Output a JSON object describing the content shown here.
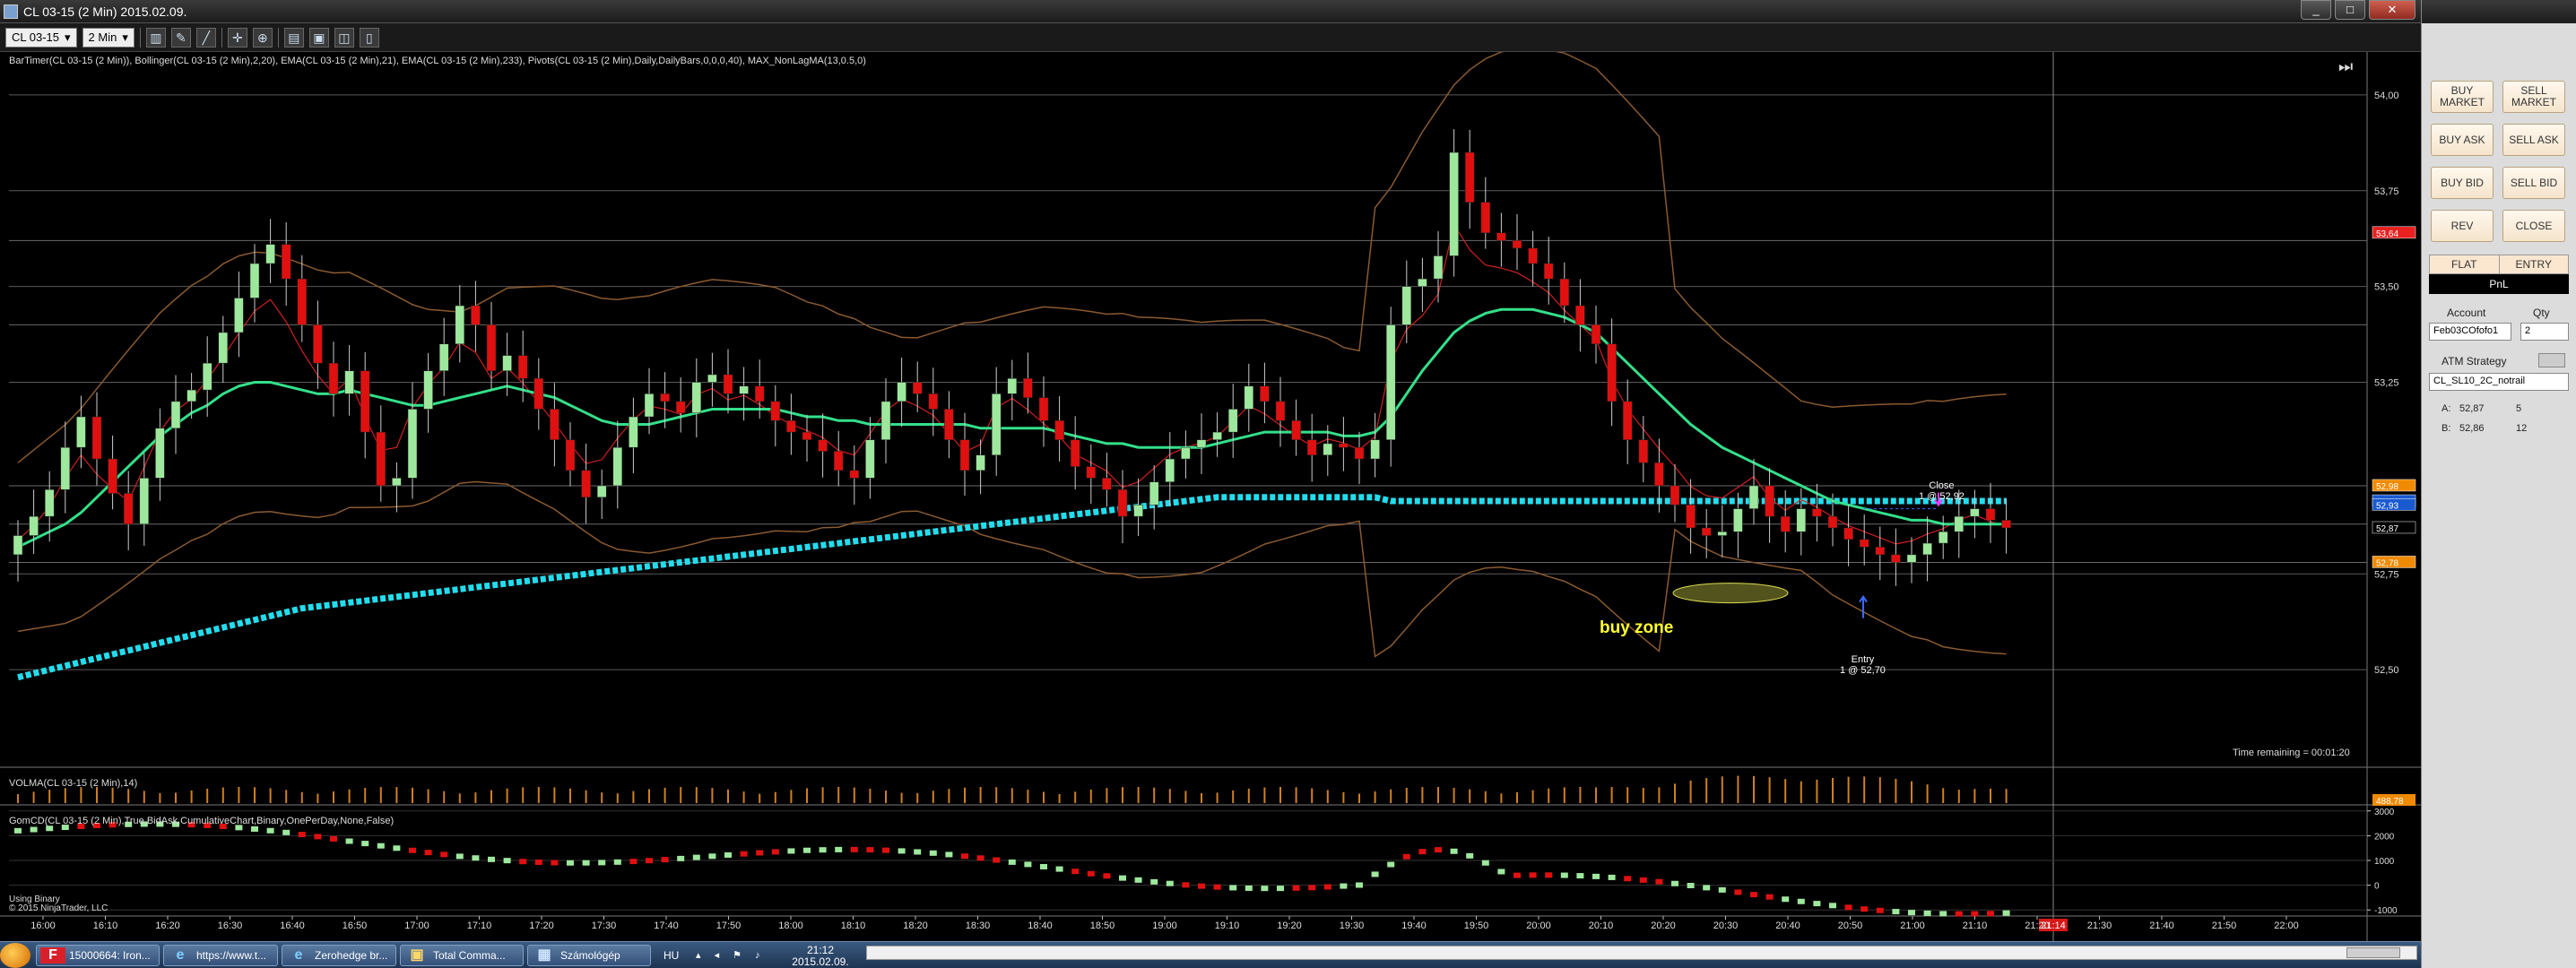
{
  "window": {
    "title": "CL 03-15 (2 Min)  2015.02.09.",
    "min_glyph": "_",
    "max_glyph": "□",
    "close_glyph": "✕"
  },
  "toolbar": {
    "instrument": "CL 03-15",
    "interval": "2 Min",
    "dropdown_glyph": "▾",
    "icons": [
      "bar-type-icon",
      "pencil-icon",
      "draw-tools-icon",
      "crosshair-icon",
      "zoom-icon",
      "properties-icon",
      "data-box-icon",
      "chart-trader-icon",
      "template-icon"
    ]
  },
  "chart": {
    "indicator_line": "BarTimer(CL 03-15 (2 Min)), Bollinger(CL 03-15 (2 Min),2,20), EMA(CL 03-15 (2 Min),21), EMA(CL 03-15 (2 Min),233), Pivots(CL 03-15 (2 Min),Daily,DailyBars,0,0,0,40), MAX_NonLagMA(13,0.5,0)",
    "time_remaining": "Time remaining = 00:01:20",
    "volma_label": "VOLMA(CL 03-15 (2 Min),14)",
    "gom_label": "GomCD(CL 03-15 (2 Min),True,BidAsk,CumulativeChart,Binary,OnePerDay,None,False)",
    "using_binary": "Using Binary",
    "copyright": "© 2015 NinjaTrader, LLC",
    "annotation": "buy zone",
    "entry_label": "Entry",
    "entry_detail": "1 @ 52,70",
    "close_label": "Close",
    "close_detail": "1 @ 52,92",
    "jump_glyph": "⏭",
    "colors": {
      "up_bar": "#9ee89e",
      "down_bar": "#e01010",
      "ema21": "#33e08a",
      "ema233": "#22ddee",
      "bollinger": "#8a5a30",
      "grid": "#5a5a5a"
    }
  },
  "chart_data": {
    "type": "candlestick",
    "x_tick_labels": [
      "16:00",
      "16:10",
      "16:20",
      "16:30",
      "16:40",
      "16:50",
      "17:00",
      "17:10",
      "17:20",
      "17:30",
      "17:40",
      "17:50",
      "18:00",
      "18:10",
      "18:20",
      "18:30",
      "18:40",
      "18:50",
      "19:00",
      "19:10",
      "19:20",
      "19:30",
      "19:40",
      "19:50",
      "20:00",
      "20:10",
      "20:20",
      "20:30",
      "20:40",
      "20:50",
      "21:00",
      "21:10",
      "21:14",
      "21:20",
      "21:30",
      "21:40",
      "21:50",
      "22:00"
    ],
    "current_time": "21:14",
    "price_ticks": [
      "54,00",
      "53,75",
      "53,50",
      "53,25",
      "52,75",
      "52,50"
    ],
    "price_ticks_values": [
      54.0,
      53.75,
      53.5,
      53.25,
      52.75,
      52.5
    ],
    "price_range": [
      52.25,
      54.07
    ],
    "price_markers": [
      {
        "label": "53,64",
        "value": 53.64,
        "color": "#e82020"
      },
      {
        "label": "52,98",
        "value": 52.98,
        "color": "#f08a00"
      },
      {
        "label": "52,94",
        "value": 52.94,
        "color": "#1a5ad0"
      },
      {
        "label": "52,93",
        "value": 52.93,
        "color": "#1a5ad0"
      },
      {
        "label": "52,87",
        "value": 52.87,
        "color": "#000000"
      },
      {
        "label": "52,78",
        "value": 52.78,
        "color": "#f08a00"
      }
    ],
    "volume_marker": {
      "label": "488,78",
      "color": "#f08a00"
    },
    "cd_ticks": [
      "3000",
      "2000",
      "1000",
      "0",
      "-1000"
    ],
    "cd_ticks_values": [
      3000,
      2000,
      1000,
      0,
      -1000
    ],
    "cd_range": [
      -1100,
      3100
    ],
    "closes": [
      52.85,
      52.9,
      52.97,
      53.08,
      53.16,
      53.05,
      52.96,
      52.88,
      53.0,
      53.13,
      53.2,
      53.23,
      53.3,
      53.38,
      53.47,
      53.56,
      53.61,
      53.52,
      53.4,
      53.3,
      53.22,
      53.28,
      53.12,
      52.98,
      53.0,
      53.18,
      53.28,
      53.35,
      53.45,
      53.4,
      53.28,
      53.32,
      53.26,
      53.18,
      53.1,
      53.02,
      52.95,
      52.98,
      53.08,
      53.16,
      53.22,
      53.2,
      53.17,
      53.25,
      53.27,
      53.22,
      53.24,
      53.2,
      53.15,
      53.12,
      53.1,
      53.07,
      53.02,
      53.0,
      53.1,
      53.2,
      53.25,
      53.22,
      53.18,
      53.1,
      53.02,
      53.06,
      53.22,
      53.26,
      53.21,
      53.15,
      53.1,
      53.03,
      53.0,
      52.97,
      52.9,
      52.93,
      52.99,
      53.05,
      53.08,
      53.1,
      53.12,
      53.18,
      53.24,
      53.2,
      53.15,
      53.1,
      53.06,
      53.09,
      53.08,
      53.05,
      53.1,
      53.4,
      53.5,
      53.52,
      53.58,
      53.85,
      53.72,
      53.64,
      53.62,
      53.6,
      53.56,
      53.52,
      53.45,
      53.4,
      53.35,
      53.2,
      53.1,
      53.04,
      52.98,
      52.93,
      52.87,
      52.85,
      52.86,
      52.92,
      52.98,
      52.9,
      52.86,
      52.92,
      52.9,
      52.87,
      52.84,
      52.82,
      52.8,
      52.78,
      52.8,
      52.83,
      52.86,
      52.9,
      52.92,
      52.89,
      52.87
    ],
    "ema21": [
      52.82,
      52.84,
      52.86,
      52.88,
      52.91,
      52.95,
      52.99,
      53.03,
      53.07,
      53.11,
      53.14,
      53.17,
      53.19,
      53.22,
      53.24,
      53.25,
      53.25,
      53.24,
      53.23,
      53.22,
      53.22,
      53.23,
      53.22,
      53.21,
      53.2,
      53.19,
      53.19,
      53.2,
      53.21,
      53.22,
      53.23,
      53.24,
      53.23,
      53.22,
      53.21,
      53.19,
      53.17,
      53.15,
      53.14,
      53.14,
      53.14,
      53.15,
      53.16,
      53.17,
      53.18,
      53.18,
      53.18,
      53.18,
      53.18,
      53.17,
      53.16,
      53.16,
      53.15,
      53.15,
      53.14,
      53.14,
      53.14,
      53.14,
      53.14,
      53.14,
      53.14,
      53.13,
      53.13,
      53.13,
      53.13,
      53.13,
      53.12,
      53.11,
      53.1,
      53.09,
      53.09,
      53.08,
      53.08,
      53.08,
      53.08,
      53.08,
      53.09,
      53.1,
      53.11,
      53.12,
      53.12,
      53.12,
      53.12,
      53.12,
      53.11,
      53.11,
      53.12,
      53.16,
      53.22,
      53.28,
      53.33,
      53.38,
      53.41,
      53.43,
      53.44,
      53.44,
      53.44,
      53.43,
      53.42,
      53.4,
      53.38,
      53.34,
      53.3,
      53.26,
      53.22,
      53.18,
      53.14,
      53.11,
      53.08,
      53.06,
      53.04,
      53.02,
      53.0,
      52.98,
      52.96,
      52.94,
      52.93,
      52.92,
      52.91,
      52.9,
      52.89,
      52.89,
      52.88,
      52.88,
      52.88,
      52.88,
      52.88
    ],
    "ema233": [
      52.48,
      52.49,
      52.5,
      52.51,
      52.52,
      52.53,
      52.54,
      52.55,
      52.56,
      52.57,
      52.58,
      52.59,
      52.6,
      52.61,
      52.62,
      52.63,
      52.64,
      52.65,
      52.66,
      52.665,
      52.67,
      52.675,
      52.68,
      52.685,
      52.69,
      52.695,
      52.7,
      52.705,
      52.71,
      52.715,
      52.72,
      52.725,
      52.73,
      52.735,
      52.74,
      52.745,
      52.75,
      52.755,
      52.76,
      52.765,
      52.77,
      52.775,
      52.78,
      52.785,
      52.79,
      52.795,
      52.8,
      52.805,
      52.81,
      52.815,
      52.82,
      52.825,
      52.83,
      52.835,
      52.84,
      52.845,
      52.85,
      52.855,
      52.86,
      52.865,
      52.87,
      52.875,
      52.88,
      52.885,
      52.89,
      52.895,
      52.9,
      52.905,
      52.91,
      52.915,
      52.92,
      52.925,
      52.93,
      52.935,
      52.94,
      52.945,
      52.95,
      52.95,
      52.95,
      52.95,
      52.95,
      52.95,
      52.95,
      52.95,
      52.95,
      52.95,
      52.95,
      52.94,
      52.94,
      52.94,
      52.94,
      52.94,
      52.94,
      52.94,
      52.94,
      52.94,
      52.94,
      52.94,
      52.94,
      52.94,
      52.94,
      52.94,
      52.94,
      52.94,
      52.94,
      52.94,
      52.94,
      52.94,
      52.94,
      52.94,
      52.94,
      52.94,
      52.94,
      52.94,
      52.94,
      52.94,
      52.94,
      52.94,
      52.94,
      52.94,
      52.94,
      52.94,
      52.94,
      52.94,
      52.94,
      52.94,
      52.94
    ],
    "cumulative_delta_start": 2200,
    "cumulative_delta_end": -750,
    "entry_price": 52.7,
    "close_price": 52.92
  },
  "order_panel": {
    "buy_market": "BUY MARKET",
    "sell_market": "SELL MARKET",
    "buy_ask": "BUY ASK",
    "sell_ask": "SELL ASK",
    "buy_bid": "BUY BID",
    "sell_bid": "SELL BID",
    "rev": "REV",
    "close": "CLOSE",
    "flat": "FLAT",
    "entry": "ENTRY",
    "pnl": "PnL",
    "account_label": "Account",
    "account_value": "Feb03COfofo1",
    "qty_label": "Qty",
    "qty_value": "2",
    "atm_label": "ATM Strategy",
    "atm_value": "CL_SL10_2C_notrail",
    "ask_label": "A:",
    "ask_price": "52,87",
    "ask_size": "5",
    "bid_label": "B:",
    "bid_price": "52,86",
    "bid_size": "12"
  },
  "taskbar": {
    "items": [
      {
        "icon": "F",
        "label": "15000664: Iron..."
      },
      {
        "icon": "e",
        "label": "https://www.t..."
      },
      {
        "icon": "e",
        "label": "Zerohedge br..."
      },
      {
        "icon": "▣",
        "label": "Total Comma..."
      },
      {
        "icon": "▦",
        "label": "Számológép"
      }
    ],
    "language": "HU",
    "tray": "▴ ◂ ⚑ ♪",
    "time": "21:12",
    "date": "2015.02.09."
  }
}
